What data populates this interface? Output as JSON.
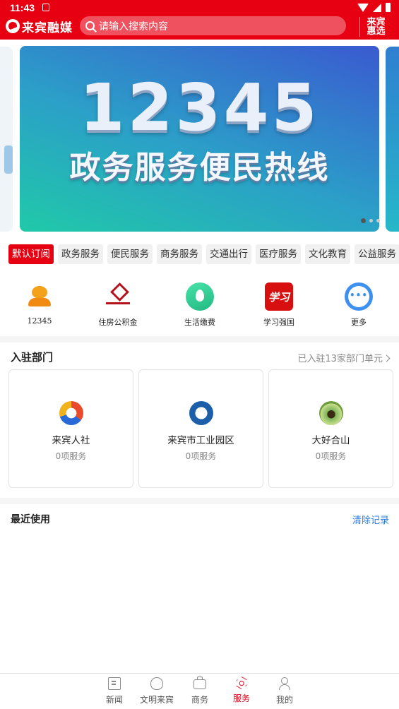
{
  "status_bar": {
    "time": "11:43"
  },
  "header": {
    "logo_text": "来宾融媒",
    "search_placeholder": "请输入搜索内容",
    "right_button_line1": "来宾",
    "right_button_line2": "惠选"
  },
  "banner": {
    "headline": "12345",
    "subline": "政务服务便民热线",
    "page_count": 3,
    "active_page": 1
  },
  "category_tabs": [
    {
      "label": "默认订阅",
      "active": true
    },
    {
      "label": "政务服务",
      "active": false
    },
    {
      "label": "便民服务",
      "active": false
    },
    {
      "label": "商务服务",
      "active": false
    },
    {
      "label": "交通出行",
      "active": false
    },
    {
      "label": "医疗服务",
      "active": false
    },
    {
      "label": "文化教育",
      "active": false
    },
    {
      "label": "公益服务",
      "active": false
    }
  ],
  "quick_services": [
    {
      "label": "12345",
      "icon": "customer-service-icon"
    },
    {
      "label": "住房公积金",
      "icon": "housing-fund-icon"
    },
    {
      "label": "生活缴费",
      "icon": "water-drop-icon"
    },
    {
      "label": "学习强国",
      "icon": "xuexi-icon"
    },
    {
      "label": "更多",
      "icon": "more-icon"
    }
  ],
  "departments": {
    "title": "入驻部门",
    "summary": "已入驻13家部门单元",
    "items": [
      {
        "name": "来宾人社",
        "count": "0项服务"
      },
      {
        "name": "来宾市工业园区",
        "count": "0项服务"
      },
      {
        "name": "大好合山",
        "count": "0项服务"
      }
    ]
  },
  "recent": {
    "title": "最近使用",
    "clear_label": "清除记录"
  },
  "bottom_nav": [
    {
      "label": "新闻",
      "active": false
    },
    {
      "label": "文明来宾",
      "active": false
    },
    {
      "label": "商务",
      "active": false
    },
    {
      "label": "服务",
      "active": true
    },
    {
      "label": "我的",
      "active": false
    }
  ],
  "colors": {
    "brand_red": "#e60012",
    "link_blue": "#2b7ce0"
  }
}
